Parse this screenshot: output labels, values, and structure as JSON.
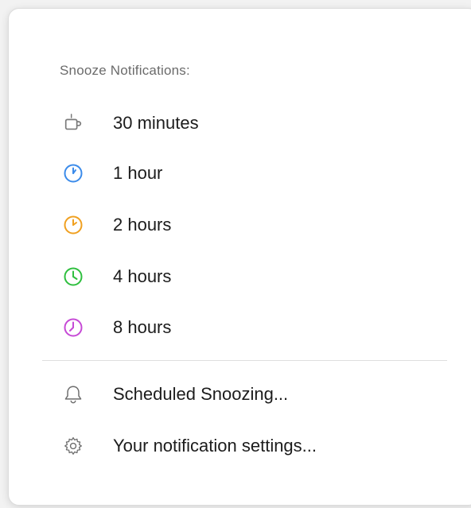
{
  "menu": {
    "section_title": "Snooze Notifications:",
    "snooze_options": [
      {
        "label": "30 minutes",
        "icon": "coffee-cup-icon",
        "color": "#7a7a7a"
      },
      {
        "label": "1 hour",
        "icon": "clock-icon",
        "color": "#3b8bea"
      },
      {
        "label": "2 hours",
        "icon": "clock-icon",
        "color": "#f0a020"
      },
      {
        "label": "4 hours",
        "icon": "clock-icon",
        "color": "#2fbf3f"
      },
      {
        "label": "8 hours",
        "icon": "clock-icon",
        "color": "#c64ad6"
      }
    ],
    "actions": [
      {
        "label": "Scheduled Snoozing...",
        "icon": "bell-icon"
      },
      {
        "label": "Your notification settings...",
        "icon": "gear-icon"
      }
    ]
  }
}
